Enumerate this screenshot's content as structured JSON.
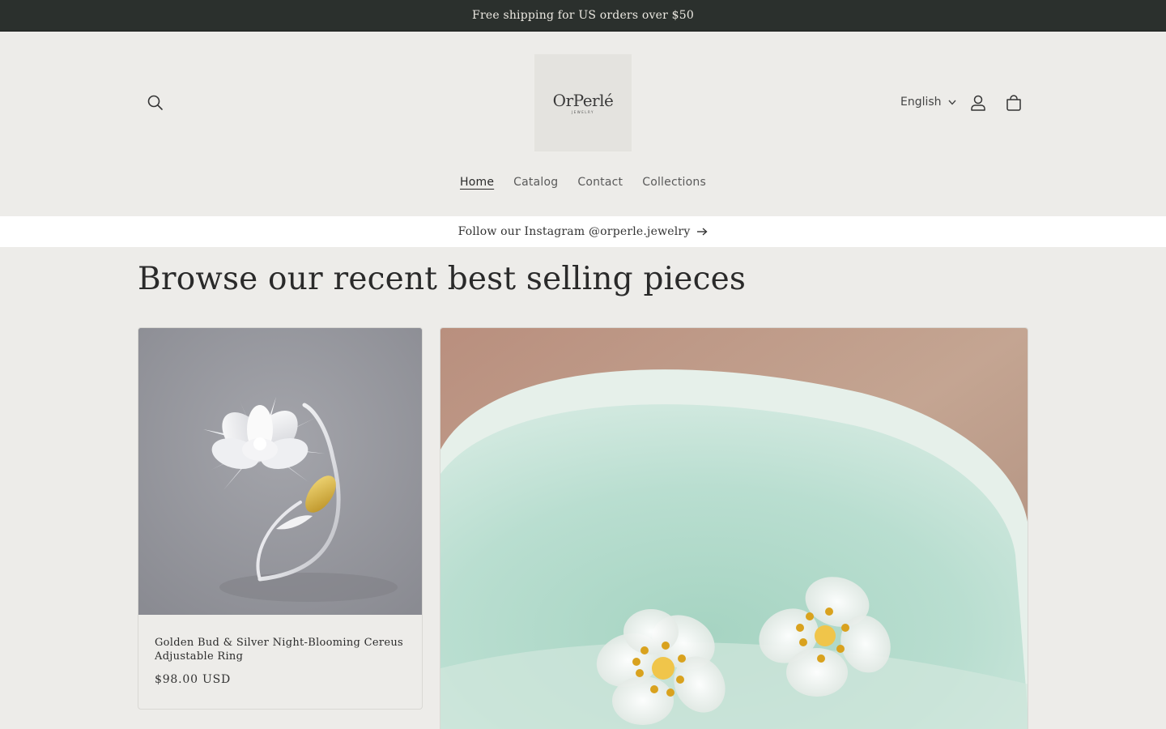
{
  "announcement": {
    "text": "Free shipping for US orders over $50"
  },
  "header": {
    "logo": {
      "wordmark": "OrPerlé",
      "subtext": "JEWELRY"
    },
    "language": {
      "selected": "English"
    },
    "icons": {
      "search": "search-icon",
      "account": "user-icon",
      "cart": "cart-icon"
    }
  },
  "nav": {
    "items": [
      {
        "label": "Home",
        "active": true
      },
      {
        "label": "Catalog"
      },
      {
        "label": "Contact"
      },
      {
        "label": "Collections"
      }
    ]
  },
  "instagram_bar": {
    "text": "Follow our Instagram @orperle.jewelry"
  },
  "featured": {
    "title": "Browse our recent best selling pieces",
    "products": [
      {
        "title": "Golden Bud & Silver Night-Blooming Cereus Adjustable Ring",
        "price": "$98.00 USD"
      }
    ]
  },
  "colors": {
    "announcement_bg": "#2b302d",
    "page_bg": "#edece9",
    "instagram_bar_bg": "#ffffff",
    "text": "#2b2b2b"
  }
}
